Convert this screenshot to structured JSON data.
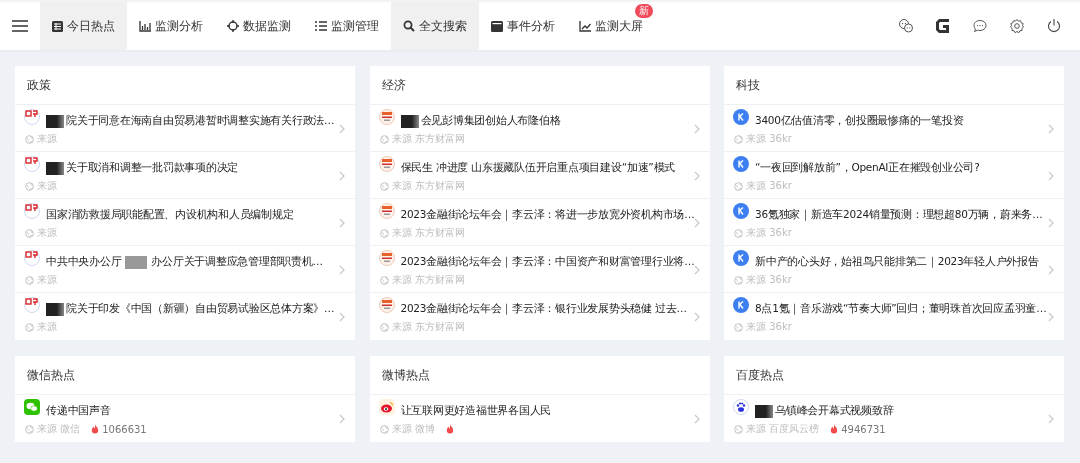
{
  "nav": {
    "tabs": [
      {
        "label": "今日热点",
        "kind": "table",
        "selected": true
      },
      {
        "label": "监测分析",
        "kind": "bars",
        "selected": false
      },
      {
        "label": "数据监测",
        "kind": "crosshair",
        "selected": false
      },
      {
        "label": "监测管理",
        "kind": "list",
        "selected": false
      },
      {
        "label": "全文搜索",
        "kind": "search",
        "selected": true
      },
      {
        "label": "事件分析",
        "kind": "card",
        "selected": false
      },
      {
        "label": "监测大屏",
        "kind": "trend",
        "selected": false,
        "badge": "新"
      }
    ],
    "tools": [
      {
        "kind": "chat-faces"
      },
      {
        "kind": "g-logo"
      },
      {
        "kind": "message"
      },
      {
        "kind": "settings"
      },
      {
        "kind": "power"
      }
    ]
  },
  "cards": [
    {
      "title": "政策",
      "kind": "gov",
      "items": [
        {
          "title_parts": [
            "院关于同意在海南自由贸易港暂时调整实施有关行政法…"
          ],
          "redacted_lead": true,
          "source": "来源",
          "hot": false
        },
        {
          "title_parts": [
            "关于取消和调整一批罚款事项的决定"
          ],
          "redacted_lead": true,
          "source": "来源",
          "hot": false
        },
        {
          "title_parts": [
            "国家消防救援局职能配置、内设机构和人员编制规定"
          ],
          "redacted_lead": false,
          "source": "来源",
          "hot": false
        },
        {
          "title_parts": [
            "中共中央办公厅",
            "办公厅关于调整应急管理部职责机…"
          ],
          "redacted_lead": false,
          "source": "来源",
          "hot": false
        },
        {
          "title_parts": [
            "院关于印发《中国（新疆）自由贸易试验区总体方案》…"
          ],
          "redacted_lead": true,
          "source": "来源",
          "hot": false
        }
      ]
    },
    {
      "title": "经济",
      "kind": "eastmoney",
      "items": [
        {
          "title_parts": [
            "会见彭博集团创始人布隆伯格"
          ],
          "redacted_lead": true,
          "source": "来源 东方财富网",
          "hot": false
        },
        {
          "title_parts": [
            "保民生 冲进度 山东援藏队伍开启重点项目建设“加速”模式"
          ],
          "redacted_lead": false,
          "source": "来源 东方财富网",
          "hot": false
        },
        {
          "title_parts": [
            "2023金融街论坛年会｜李云泽：将进一步放宽外资机构市场…"
          ],
          "redacted_lead": false,
          "source": "来源 东方财富网",
          "hot": false
        },
        {
          "title_parts": [
            "2023金融街论坛年会｜李云泽：中国资产和财富管理行业将…"
          ],
          "redacted_lead": false,
          "source": "来源 东方财富网",
          "hot": false
        },
        {
          "title_parts": [
            "2023金融街论坛年会｜李云泽：银行业发展势头稳健 过去…"
          ],
          "redacted_lead": false,
          "source": "来源 东方财富网",
          "hot": false
        }
      ]
    },
    {
      "title": "科技",
      "kind": "kr",
      "items": [
        {
          "title_parts": [
            "3400亿估值清零，创投圈最惨痛的一笔投资"
          ],
          "redacted_lead": false,
          "source": "来源 36kr",
          "hot": false
        },
        {
          "title_parts": [
            "“一夜回到解放前”，OpenAI正在摧毁创业公司?"
          ],
          "redacted_lead": false,
          "source": "来源 36kr",
          "hot": false
        },
        {
          "title_parts": [
            "36氪独家｜新造车2024销量预测：理想超80万辆，蔚来务…"
          ],
          "redacted_lead": false,
          "source": "来源 36kr",
          "hot": false
        },
        {
          "title_parts": [
            "新中产的心头好，始祖鸟只能排第二｜2023年轻人户外报告"
          ],
          "redacted_lead": false,
          "source": "来源 36kr",
          "hot": false
        },
        {
          "title_parts": [
            "8点1氪｜音乐游戏“节奏大师”回归；董明珠首次回应孟羽童…"
          ],
          "redacted_lead": false,
          "source": "来源 36kr",
          "hot": false
        }
      ]
    },
    {
      "title": "微信热点",
      "kind": "wechat",
      "items": [
        {
          "title_parts": [
            "传递中国声音"
          ],
          "redacted_lead": false,
          "source": "来源 微信",
          "hot": true,
          "heat": "1066631"
        }
      ]
    },
    {
      "title": "微博热点",
      "kind": "weibo",
      "items": [
        {
          "title_parts": [
            "让互联网更好造福世界各国人民"
          ],
          "redacted_lead": false,
          "source": "来源 微博",
          "hot": true
        }
      ]
    },
    {
      "title": "百度热点",
      "kind": "baidu",
      "items": [
        {
          "title_parts": [
            "乌镇峰会开幕式视频致辞"
          ],
          "redacted_lead": true,
          "source": "来源 百度风云榜",
          "hot": true,
          "heat": "4946731"
        }
      ]
    }
  ]
}
